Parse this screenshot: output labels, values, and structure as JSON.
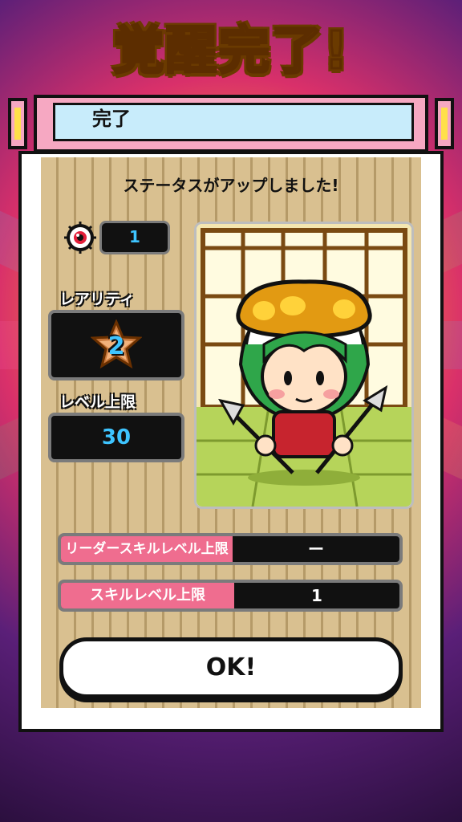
{
  "title": "覚醒完了!",
  "header_label": "完了",
  "message": "ステータスがアップしました!",
  "eyeball_count": "1",
  "rarity": {
    "label": "レアリティ",
    "value": "2"
  },
  "level_cap": {
    "label": "レベル上限",
    "value": "30"
  },
  "leader_skill": {
    "label": "リーダースキルレベル上限",
    "value": "ー"
  },
  "skill": {
    "label": "スキルレベル上限",
    "value": "1"
  },
  "ok_button": "OK!",
  "icons": [
    "eyeball-icon",
    "star-rarity-icon",
    "character-portrait"
  ],
  "colors": {
    "pink": "#f6a8c2",
    "lightblue": "#c8ecfb",
    "accent_blue": "#3ec4ff",
    "skill_pink": "#ef6d8f"
  }
}
